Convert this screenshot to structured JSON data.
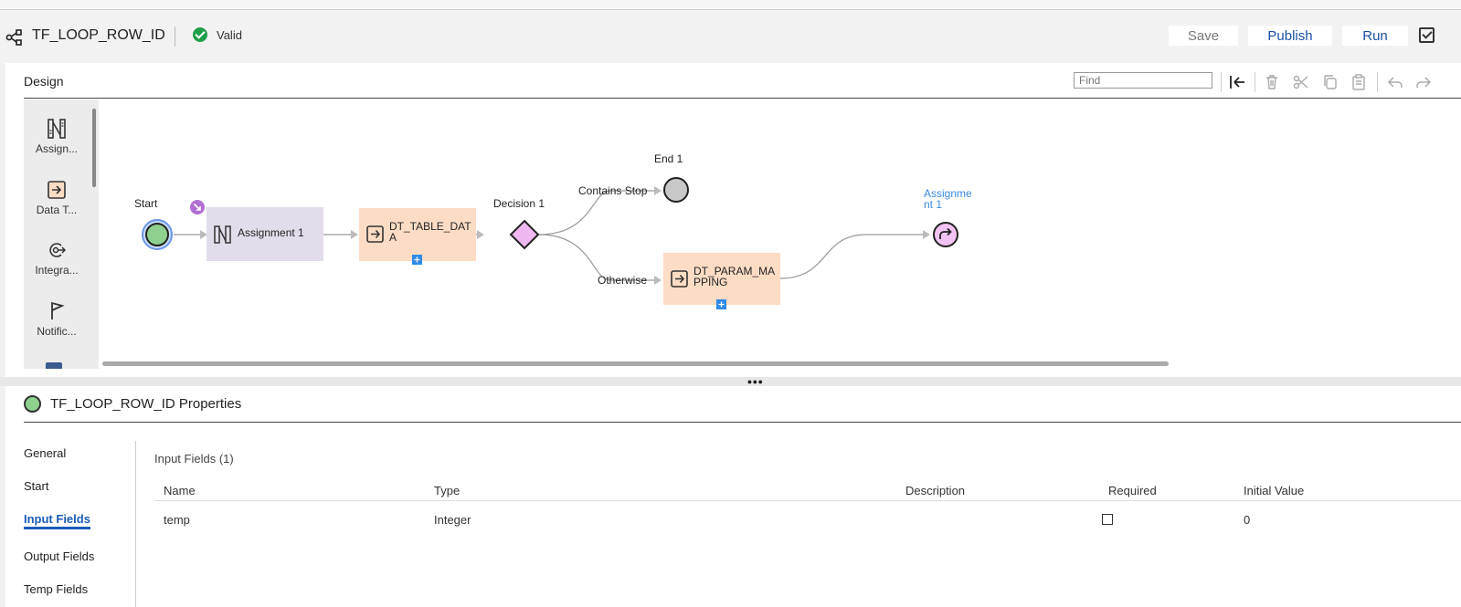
{
  "header": {
    "title": "TF_LOOP_ROW_ID",
    "status": "Valid",
    "buttons": {
      "save": "Save",
      "publish": "Publish",
      "run": "Run"
    }
  },
  "design": {
    "title": "Design",
    "find_placeholder": "Find",
    "palette": [
      {
        "label": "Assign...",
        "icon": "assignment-icon"
      },
      {
        "label": "Data T...",
        "icon": "data-task-icon"
      },
      {
        "label": "Integra...",
        "icon": "integration-icon"
      },
      {
        "label": "Notific...",
        "icon": "notification-icon"
      }
    ],
    "nodes": {
      "start": "Start",
      "assignment": "Assignment 1",
      "dt_table": {
        "line1": "DT_TABLE_DAT",
        "line2": "A"
      },
      "decision": "Decision 1",
      "end": "End 1",
      "dt_param": {
        "line1": "DT_PARAM_MA",
        "line2": "PPING"
      },
      "assignment_jump": {
        "line1": "Assignme",
        "line2": "nt 1"
      }
    },
    "branches": {
      "contains_stop": "Contains Stop",
      "otherwise": "Otherwise"
    }
  },
  "properties": {
    "title": "TF_LOOP_ROW_ID Properties",
    "nav": [
      "General",
      "Start",
      "Input Fields",
      "Output Fields",
      "Temp Fields"
    ],
    "active_nav": "Input Fields",
    "input_fields_title": "Input Fields (1)",
    "columns": [
      "Name",
      "Type",
      "Description",
      "Required",
      "Initial Value"
    ],
    "rows": [
      {
        "name": "temp",
        "type": "Integer",
        "description": "",
        "required": false,
        "initial_value": "0"
      }
    ]
  },
  "colors": {
    "valid_green": "#1f9e4a",
    "link_blue": "#1a4fa6",
    "assignment_fill": "#e3dcea",
    "data_task_fill": "#fddcc5",
    "decision_fill": "#f0b8f0",
    "start_fill": "#8fd08f",
    "end_fill": "#c8c8c8",
    "jump_fill": "#f3c3f3",
    "badge_purple": "#b070d0"
  }
}
